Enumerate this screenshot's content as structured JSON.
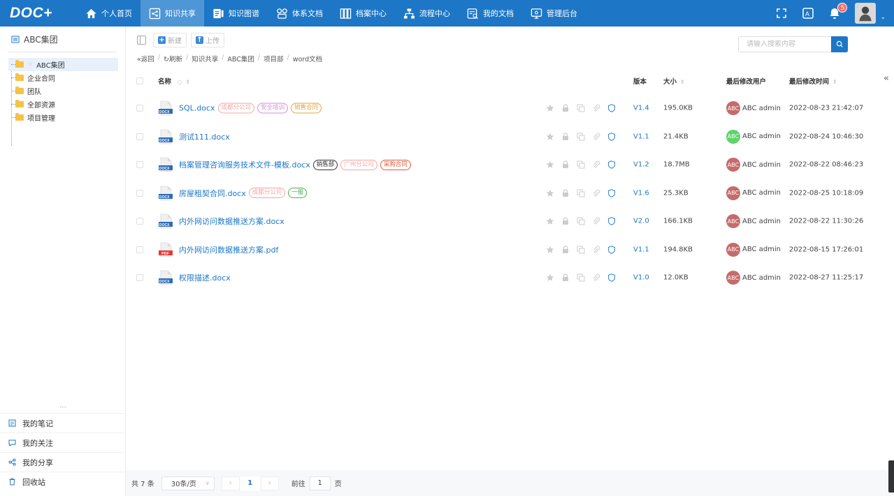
{
  "app": {
    "logo": "DOC+"
  },
  "nav": [
    {
      "label": "个人首页",
      "icon": "home-icon",
      "active": false
    },
    {
      "label": "知识共享",
      "icon": "share-icon",
      "active": true
    },
    {
      "label": "知识图谱",
      "icon": "graph-icon",
      "active": false
    },
    {
      "label": "体系文档",
      "icon": "system-icon",
      "active": false
    },
    {
      "label": "档案中心",
      "icon": "archive-icon",
      "active": false
    },
    {
      "label": "流程中心",
      "icon": "flow-icon",
      "active": false
    },
    {
      "label": "我的文档",
      "icon": "my-doc-icon",
      "active": false
    },
    {
      "label": "管理后台",
      "icon": "admin-icon",
      "active": false
    }
  ],
  "topright": {
    "notification_count": "5"
  },
  "sidebar": {
    "title": "ABC集团",
    "tree": [
      {
        "label": "ABC集团",
        "selected": true
      },
      {
        "label": "企业合同",
        "selected": false
      },
      {
        "label": "团队",
        "selected": false
      },
      {
        "label": "全部资源",
        "selected": false
      },
      {
        "label": "项目管理",
        "selected": false
      }
    ],
    "more": "...",
    "bottom": [
      {
        "label": "我的笔记",
        "icon": "note-icon"
      },
      {
        "label": "我的关注",
        "icon": "follow-icon"
      },
      {
        "label": "我的分享",
        "icon": "share-link-icon"
      },
      {
        "label": "回收站",
        "icon": "trash-icon"
      }
    ]
  },
  "toolbar": {
    "new_label": "新建",
    "upload_label": "上传"
  },
  "breadcrumb": {
    "back": "«返回",
    "refresh": "↻刷新",
    "items": [
      "知识共享",
      "ABC集团",
      "项目部",
      "word文档"
    ]
  },
  "search": {
    "placeholder": "请输入搜索内容"
  },
  "table": {
    "headers": {
      "name": "名称",
      "version": "版本",
      "size": "大小",
      "user": "最后修改用户",
      "time": "最后修改时间"
    },
    "rows": [
      {
        "type": "docx",
        "name": "SQL.docx",
        "tags": [
          {
            "text": "成都分公司",
            "color": "#f5a3a3"
          },
          {
            "text": "安全培训",
            "color": "#d98bd9"
          },
          {
            "text": "销售合同",
            "color": "#e6a23c"
          }
        ],
        "version": "V1.4",
        "size": "195.0KB",
        "user": "ABC admin",
        "avatar": "ABC",
        "avatar_color": "#c66b6b",
        "time": "2022-08-23 21:42:07"
      },
      {
        "type": "docx",
        "name": "测试111.docx",
        "tags": [],
        "version": "V1.1",
        "size": "21.4KB",
        "user": "ABC admin",
        "avatar": "ABC",
        "avatar_color": "#5ed36a",
        "time": "2022-08-24 10:46:30"
      },
      {
        "type": "docx",
        "name": "档案管理咨询服务技术文件-模板.docx",
        "tags": [
          {
            "text": "销售部",
            "color": "#333333"
          },
          {
            "text": "广州分公司",
            "color": "#f5a3a3"
          },
          {
            "text": "采购合同",
            "color": "#e0593a"
          }
        ],
        "version": "V1.2",
        "size": "18.7MB",
        "user": "ABC admin",
        "avatar": "ABC",
        "avatar_color": "#c66b6b",
        "time": "2022-08-22 08:46:23"
      },
      {
        "type": "docx",
        "name": "房屋租契合同.docx",
        "tags": [
          {
            "text": "成都分公司",
            "color": "#f5a3a3"
          },
          {
            "text": "一般",
            "color": "#4caf50"
          }
        ],
        "version": "V1.6",
        "size": "25.3KB",
        "user": "ABC admin",
        "avatar": "ABC",
        "avatar_color": "#c66b6b",
        "time": "2022-08-25 10:18:09"
      },
      {
        "type": "docx",
        "name": "内外网访问数据推送方案.docx",
        "tags": [],
        "version": "V2.0",
        "size": "166.1KB",
        "user": "ABC admin",
        "avatar": "ABC",
        "avatar_color": "#c66b6b",
        "time": "2022-08-22 11:30:26"
      },
      {
        "type": "pdf",
        "name": "内外网访问数据推送方案.pdf",
        "tags": [],
        "version": "V1.1",
        "size": "194.8KB",
        "user": "ABC admin",
        "avatar": "ABC",
        "avatar_color": "#c66b6b",
        "time": "2022-08-15 17:26:01"
      },
      {
        "type": "docx",
        "name": "权限描述.docx",
        "tags": [],
        "version": "V1.0",
        "size": "12.0KB",
        "user": "ABC admin",
        "avatar": "ABC",
        "avatar_color": "#c66b6b",
        "time": "2022-08-27 11:25:17"
      }
    ]
  },
  "pager": {
    "total": "共 7 条",
    "page_size": "30条/页",
    "current": "1",
    "goto_label": "前往",
    "goto_value": "1",
    "page_unit": "页"
  },
  "colors": {
    "primary": "#1d77c6",
    "nav_active": "#4f96d6"
  }
}
